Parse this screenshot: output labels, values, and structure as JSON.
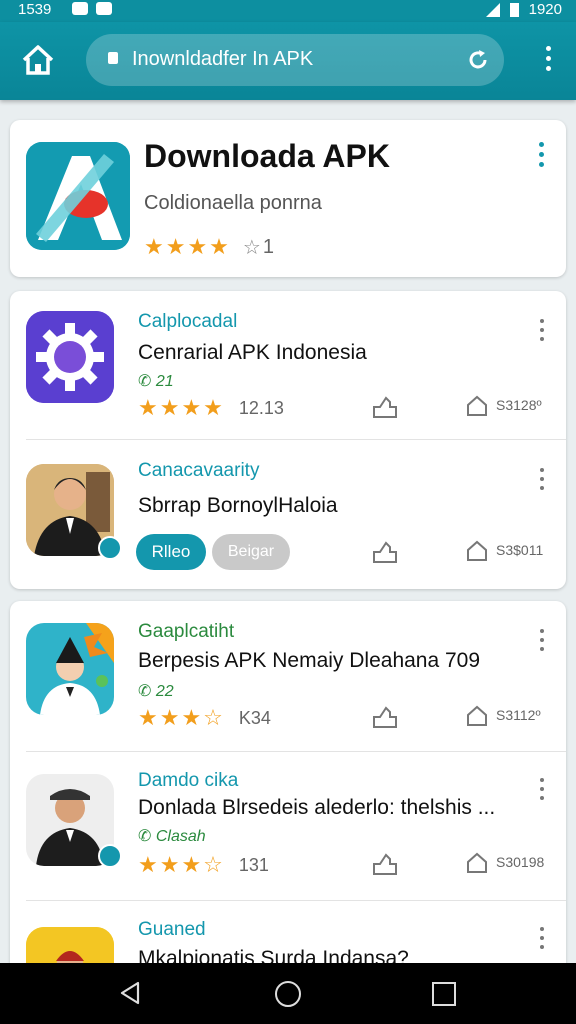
{
  "status_bar": {
    "time": "1539",
    "right_text": "1920"
  },
  "browser": {
    "url": "Inownldadfer In APK"
  },
  "featured": {
    "title": "Downloada APK",
    "subtitle": "Coldionaella ponrna",
    "rating_count": "1",
    "stars_filled": 4
  },
  "apps": [
    {
      "developer": "Calplocadal",
      "name": "Cenrarial APK Indonesia",
      "meta": "✆ 21",
      "stars": "★★★★",
      "rating_num": "12.13",
      "size": "S3128º"
    },
    {
      "developer": "Canacavaarity",
      "name": "Sbrrap BornoylHaloia",
      "install_label": "Rlleo",
      "beta_label": "Beigar",
      "size": "S3$011"
    },
    {
      "developer": "Gaaplcatiht",
      "name": "Berpesis APK Nemaiy Dleahana 709",
      "meta": "✆ 22",
      "stars": "★★★☆",
      "rating_num": "K34",
      "size": "S3112º"
    },
    {
      "developer": "Damdo cika",
      "name": "Donlada Blrsedeis alederlo: thelshis ...",
      "meta": "✆ Clasah",
      "stars": "★★★☆",
      "rating_num": "131",
      "size": "S30198"
    },
    {
      "developer": "Guaned",
      "name": "Mkalpionatis Surda Indansa?"
    }
  ],
  "colors": {
    "accent": "#1497ad",
    "star": "#f29e1c",
    "bar": "#0d8fa0"
  }
}
